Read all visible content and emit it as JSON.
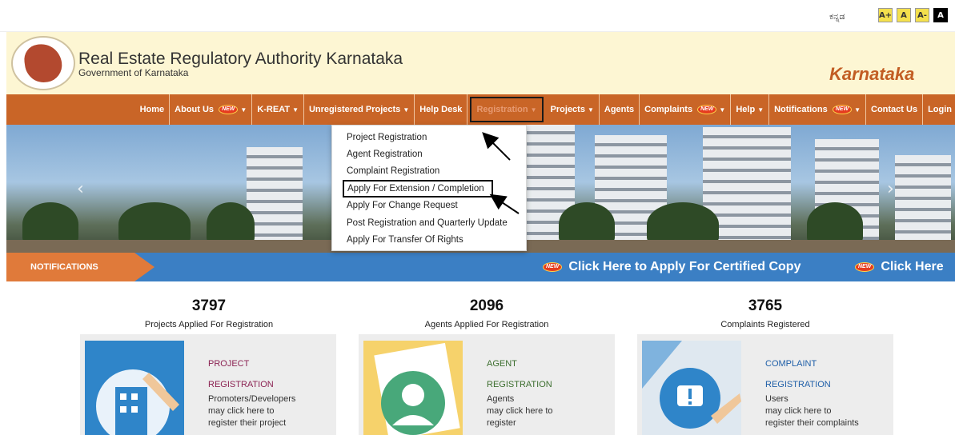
{
  "topbar": {
    "language_link": "ಕನ್ನಡ",
    "font_buttons": [
      "A+",
      "A",
      "A-",
      "A"
    ]
  },
  "header": {
    "title": "Real Estate Regulatory Authority Karnataka",
    "subtitle": "Government of Karnataka",
    "state_name": "Karnataka"
  },
  "nav": {
    "items": [
      "Home",
      "About Us",
      "K-REAT",
      "Unregistered Projects",
      "Help Desk",
      "Registration",
      "Projects",
      "Agents",
      "Complaints",
      "Help",
      "Notifications",
      "Contact Us",
      "Login"
    ],
    "new_badge": "NEW",
    "active": "Registration"
  },
  "registration_menu": {
    "items": [
      "Project Registration",
      "Agent Registration",
      "Complaint Registration",
      "Apply For Extension / Completion",
      "Apply For Change Request",
      "Post Registration and Quarterly Update",
      "Apply For Transfer Of Rights"
    ],
    "highlighted": "Apply For Extension / Completion"
  },
  "notifications": {
    "label": "NOTIFICATIONS",
    "ticker_1": "Click Here to Apply For Certified Copy",
    "ticker_2": "Click Here"
  },
  "stats": [
    {
      "value": "3797",
      "label": "Projects Applied For Registration"
    },
    {
      "value": "2096",
      "label": "Agents Applied For Registration"
    },
    {
      "value": "3765",
      "label": "Complaints Registered"
    }
  ],
  "cards": [
    {
      "title_1": "PROJECT",
      "title_2": "REGISTRATION",
      "desc_1": "Promoters/Developers",
      "desc_2": "may click here to",
      "desc_3": "register their project",
      "color": "#8b2252"
    },
    {
      "title_1": "AGENT",
      "title_2": "REGISTRATION",
      "desc_1": "Agents",
      "desc_2": "may click here to",
      "desc_3": "register",
      "color": "#3c6e2e"
    },
    {
      "title_1": "COMPLAINT",
      "title_2": "REGISTRATION",
      "desc_1": "Users",
      "desc_2": "may click here to",
      "desc_3": "register their complaints",
      "color": "#1f5fa8"
    }
  ],
  "colors": {
    "nav_bg": "#c96527",
    "header_bg": "#fdf6d3",
    "notify_bg": "#3b7fc4",
    "state_name": "#c25d23"
  }
}
